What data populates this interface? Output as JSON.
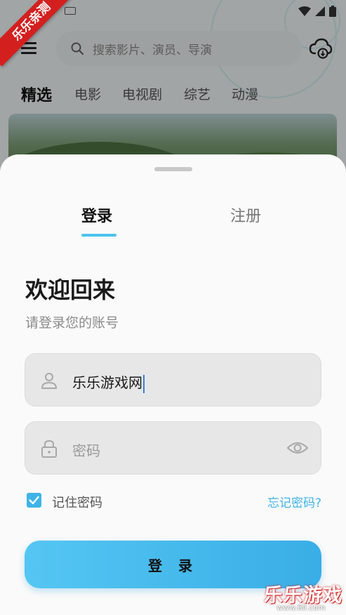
{
  "ribbon": {
    "text": "乐乐亲测"
  },
  "background_app": {
    "search": {
      "placeholder": "搜索影片、演员、导演"
    },
    "categories": [
      {
        "label": "精选",
        "active": true
      },
      {
        "label": "电影",
        "active": false
      },
      {
        "label": "电视剧",
        "active": false
      },
      {
        "label": "综艺",
        "active": false
      },
      {
        "label": "动漫",
        "active": false
      }
    ]
  },
  "login_sheet": {
    "tabs": {
      "login": "登录",
      "register": "注册"
    },
    "welcome_title": "欢迎回来",
    "subtitle": "请登录您的账号",
    "username": {
      "value": "乐乐游戏网",
      "icon": "user-icon"
    },
    "password": {
      "placeholder": "密码",
      "icon": "lock-icon",
      "toggle_icon": "eye-icon"
    },
    "remember": {
      "label": "记住密码",
      "checked": true
    },
    "forgot_label": "忘记密码?",
    "submit_label": "登 录",
    "accent_color": "#3fb4e8"
  },
  "watermark": {
    "text": "乐乐游戏",
    "url": "www.6ll.com"
  }
}
